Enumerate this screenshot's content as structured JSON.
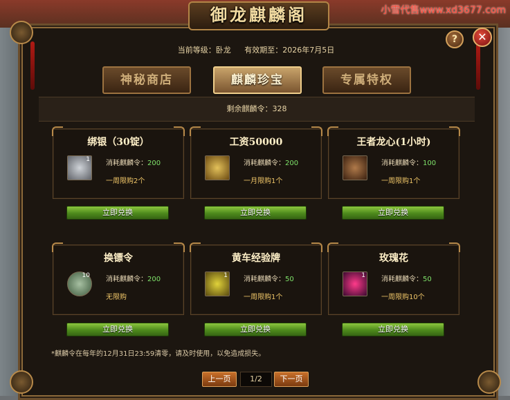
{
  "watermark": "小雪代售www.xd3677.com",
  "title": "御龙麒麟阁",
  "help_label": "?",
  "close_label": "✕",
  "info": {
    "level": "当前等级：卧龙",
    "expiry": "有效期至：2026年7月5日"
  },
  "tabs": [
    {
      "label": "神秘商店",
      "active": false
    },
    {
      "label": "麒麟珍宝",
      "active": true
    },
    {
      "label": "专属特权",
      "active": false
    }
  ],
  "remaining": "剩余麒麟令：328",
  "cost_prefix": "消耗麒麟令：",
  "items": [
    {
      "name": "绑银（30锭）",
      "qty": "1",
      "cost": "200",
      "limit": "一周限购2个",
      "icon": "silver-ingot-icon",
      "button": "立即兑换"
    },
    {
      "name": "工资50000",
      "qty": "",
      "cost": "200",
      "limit": "一月限购1个",
      "icon": "salary-coins-icon",
      "button": "立即兑换"
    },
    {
      "name": "王者龙心(1小时)",
      "qty": "",
      "cost": "100",
      "limit": "一周限购1个",
      "icon": "dragon-heart-icon",
      "button": "立即兑换"
    },
    {
      "name": "换镖令",
      "qty": "10",
      "cost": "200",
      "limit": "无限购",
      "icon": "escort-token-icon",
      "button": "立即兑换"
    },
    {
      "name": "黄车经验牌",
      "qty": "1",
      "cost": "50",
      "limit": "一周限购1个",
      "icon": "yellow-cart-exp-icon",
      "button": "立即兑换"
    },
    {
      "name": "玫瑰花",
      "qty": "1",
      "cost": "50",
      "limit": "一周限购10个",
      "icon": "rose-icon",
      "button": "立即兑换"
    }
  ],
  "note": "*麒麟令在每年的12月31日23:59清零，请及时使用，以免造成损失。",
  "pager": {
    "prev": "上一页",
    "page": "1/2",
    "next": "下一页"
  },
  "colors": {
    "accent_green": "#7fe36a",
    "limit_gold": "#f0c668",
    "button_green": "#4d8a1c",
    "frame_gold": "#b88a4a"
  }
}
